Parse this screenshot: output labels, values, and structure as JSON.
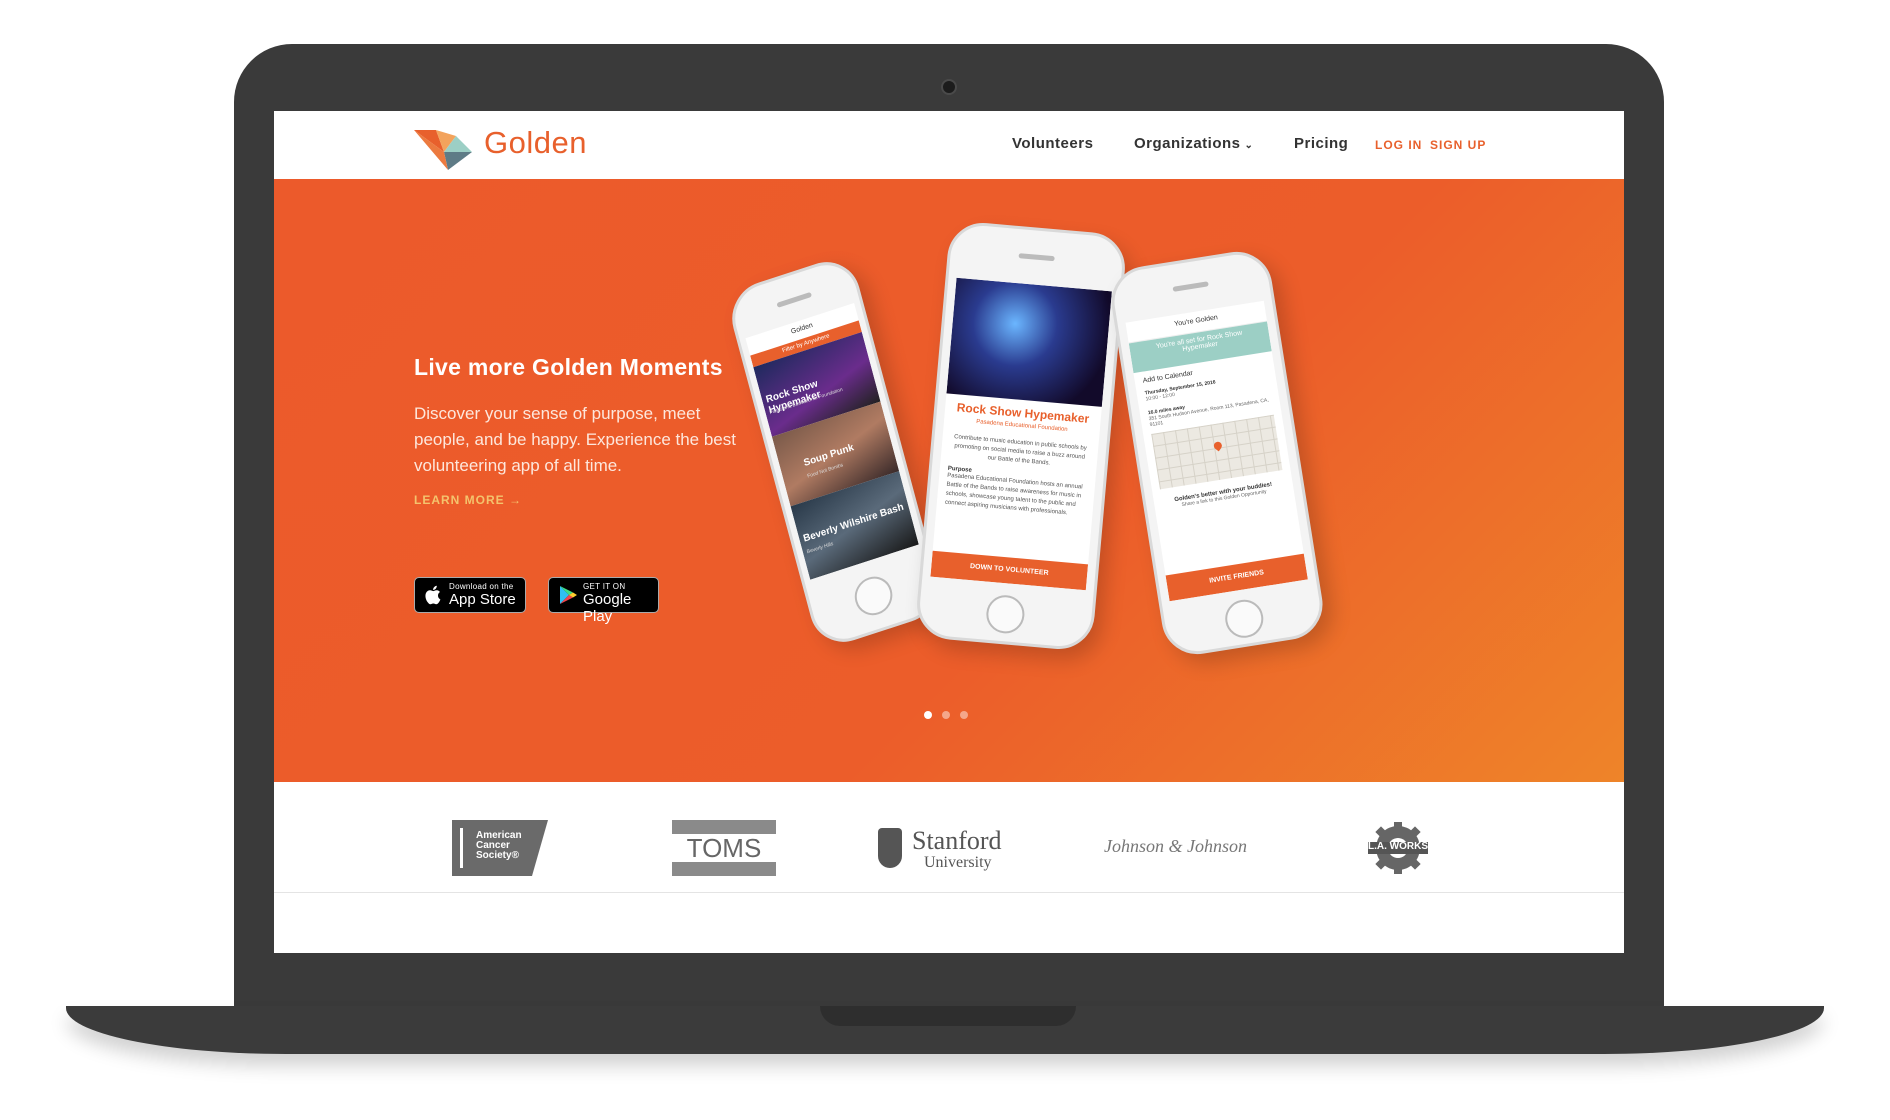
{
  "nav": {
    "brand": "Golden",
    "links": [
      "Volunteers",
      "Organizations",
      "Pricing"
    ],
    "login": "LOG IN",
    "signup": "SIGN UP"
  },
  "hero": {
    "title": "Live more Golden Moments",
    "description": "Discover your sense of purpose, meet people, and be happy. Experience the best volunteering app of all time.",
    "learn_more": "LEARN MORE →",
    "app_store": {
      "small": "Download on the",
      "big": "App Store"
    },
    "google_play": {
      "small": "GET IT ON",
      "big": "Google Play"
    },
    "carousel": {
      "count": 3,
      "active": 1
    }
  },
  "phones": {
    "left": {
      "title": "Golden",
      "filter": "Filter by Anywhere",
      "events": [
        {
          "name": "Rock Show Hypemaker",
          "org": "Pasadena Educational Foundation"
        },
        {
          "name": "Soup Punk",
          "org": "Food Not Bombs"
        },
        {
          "name": "Beverly Wilshire Bash",
          "org": "Beverly Hills"
        }
      ]
    },
    "middle": {
      "event_title": "Rock Show Hypemaker",
      "org": "Pasadena Educational Foundation",
      "summary": "Contribute to music education in public schools by promoting on social media to raise a buzz around our Battle of the Bands.",
      "purpose_label": "Purpose",
      "purpose": "Pasadena Educational Foundation hosts an annual Battle of the Bands to raise awareness for music in schools, showcase young talent to the public and connect aspiring musicians with professionals.",
      "cta": "DOWN TO VOLUNTEER"
    },
    "right": {
      "header": "You're Golden",
      "banner": "You're all set for Rock Show Hypemaker",
      "calendar_label": "Add to Calendar",
      "date": "Thursday, September 15, 2016",
      "time": "10:00 - 12:00",
      "distance": "16.0 miles away",
      "address": "351 South Hudson Avenue, Room 113, Pasadena, CA, 91101",
      "share_title": "Golden's better with your buddies!",
      "share_text": "Share a link to this Golden Opportunity",
      "cta": "INVITE FRIENDS"
    }
  },
  "partners": [
    {
      "name": "American Cancer Society",
      "lines": [
        "American",
        "Cancer",
        "Society®"
      ]
    },
    {
      "name": "TOMS",
      "lines": [
        "TOMS"
      ]
    },
    {
      "name": "Stanford University",
      "lines": [
        "Stanford",
        "University"
      ]
    },
    {
      "name": "Johnson & Johnson",
      "lines": [
        "Johnson & Johnson"
      ]
    },
    {
      "name": "L.A. Works",
      "lines": [
        "L.A. WORKS"
      ]
    }
  ],
  "colors": {
    "brand": "#e8602c",
    "hero_start": "#ec5a2b",
    "hero_end": "#ee8429",
    "teal": "#9ccfc5"
  }
}
